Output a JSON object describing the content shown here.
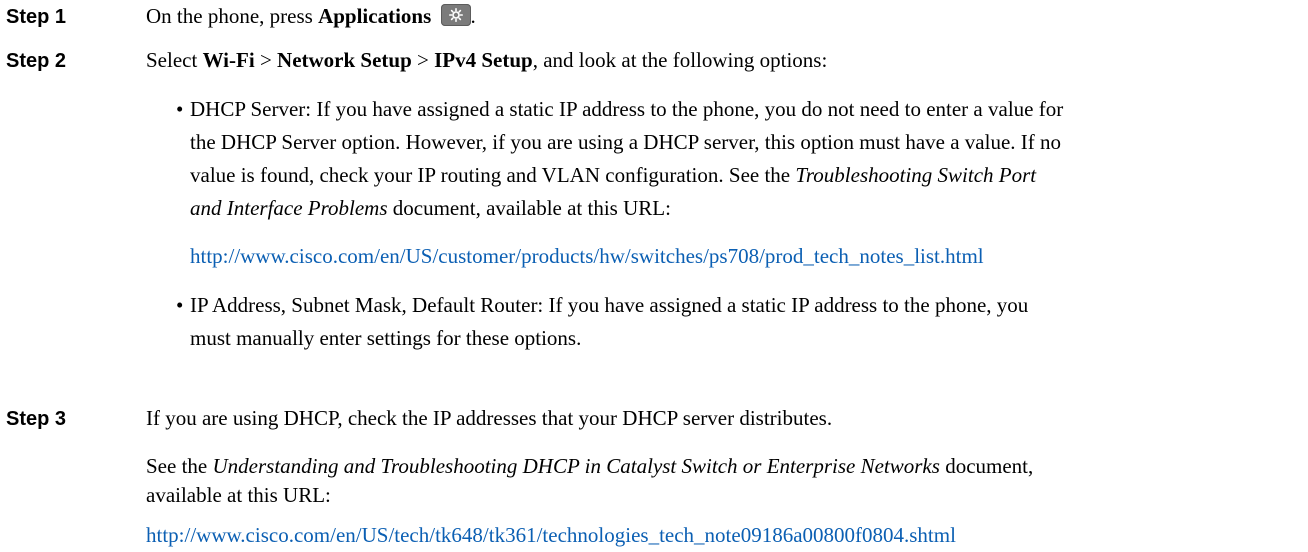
{
  "steps": [
    {
      "label": "Step 1",
      "pre": "On the phone, press ",
      "bold": "Applications",
      "icon": "gear-icon",
      "post": "."
    },
    {
      "label": "Step 2",
      "select": "Select ",
      "b1": "Wi-Fi",
      "sep1": " > ",
      "b2": "Network Setup",
      "sep2": " > ",
      "b3": "IPv4 Setup",
      "rest": ", and look at the following options:",
      "bullets": [
        {
          "lines": [
            "DHCP Server: If you have assigned a static IP address to the phone, you do not need to enter a value for",
            "the DHCP Server option. However, if you are using a DHCP server, this option must have a value. If no",
            "value is found, check your IP routing and VLAN configuration. See the "
          ],
          "italic1": "Troubleshooting Switch Port",
          "line4_italic": "and Interface Problems",
          "line4_rest": " document, available at this URL:",
          "link": "http://www.cisco.com/en/US/customer/products/hw/switches/ps708/prod_tech_notes_list.html"
        },
        {
          "line1": "IP Address, Subnet Mask, Default Router: If you have assigned a static IP address to the phone, you",
          "line2": "must manually enter settings for these options."
        }
      ]
    },
    {
      "label": "Step 3",
      "line1": "If you are using DHCP, check the IP addresses that your DHCP server distributes.",
      "see_pre": "See the ",
      "see_italic": "Understanding and Troubleshooting DHCP in Catalyst Switch or Enterprise Networks",
      "see_post": " document,",
      "see_line2": "available at this URL:",
      "link": "http://www.cisco.com/en/US/tech/tk648/tk361/technologies_tech_note09186a00800f0804.shtml"
    }
  ],
  "colors": {
    "link": "#0b5fb3",
    "icon_bg": "#7b7b7b"
  }
}
